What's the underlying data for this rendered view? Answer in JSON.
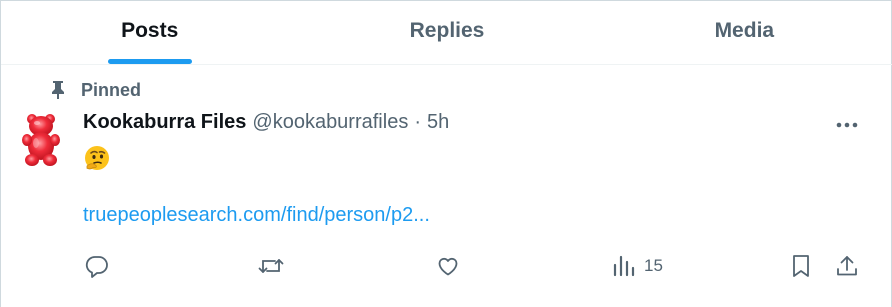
{
  "tabs": [
    {
      "label": "Posts",
      "active": true
    },
    {
      "label": "Replies",
      "active": false
    },
    {
      "label": "Media",
      "active": false
    }
  ],
  "post": {
    "pinned_label": "Pinned",
    "author_name": "Kookaburra Files",
    "author_handle": "@kookaburrafiles",
    "separator": "·",
    "time": "5h",
    "emoji": "thinking-face",
    "link_text": "truepeoplesearch.com/find/person/p2...",
    "views_count": "15",
    "actions": [
      "reply-icon",
      "repost-icon",
      "like-icon",
      "views-icon",
      "bookmark-icon",
      "share-icon"
    ]
  },
  "colors": {
    "accent": "#1d9bf0",
    "muted": "#536471",
    "text": "#0f1419",
    "avatar": "#e0202a"
  }
}
